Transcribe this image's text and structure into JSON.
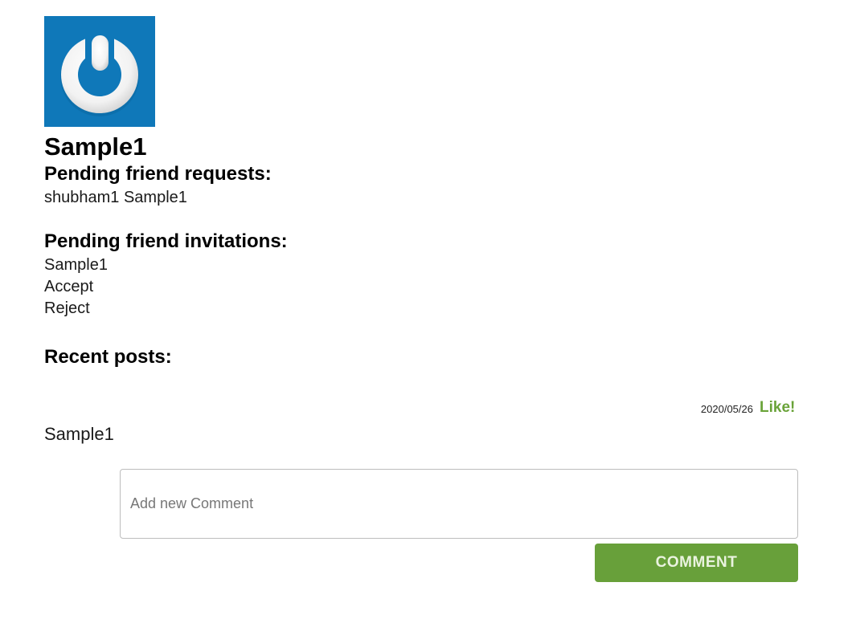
{
  "profile": {
    "avatar_icon": "power-ring-logo",
    "avatar_bg": "#0f78b9",
    "name": "Sample1"
  },
  "friend_requests": {
    "title": "Pending friend requests:",
    "items": [
      "shubham1 Sample1"
    ]
  },
  "friend_invitations": {
    "title": "Pending friend invitations:",
    "items": [
      {
        "name": "Sample1",
        "accept_label": "Accept",
        "reject_label": "Reject"
      }
    ]
  },
  "recent_posts": {
    "title": "Recent posts:",
    "posts": [
      {
        "date": "2020/05/26",
        "like_label": "Like!",
        "body": "Sample1"
      }
    ]
  },
  "comment_form": {
    "placeholder": "Add new Comment",
    "value": "",
    "button_label": "COMMENT"
  },
  "colors": {
    "accent_green": "#68a03a",
    "like_green": "#6aa339"
  }
}
